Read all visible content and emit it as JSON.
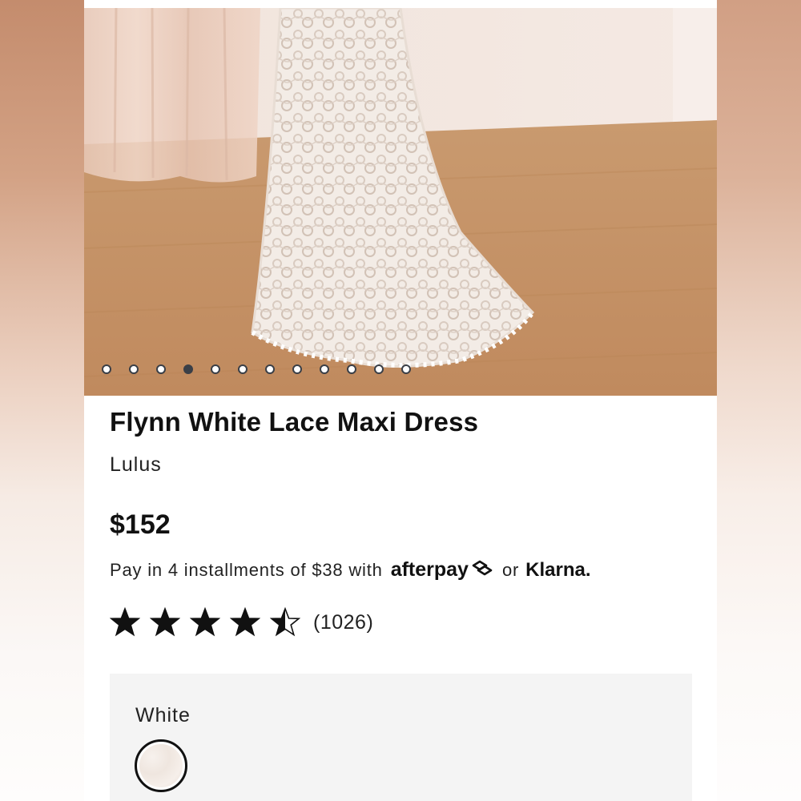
{
  "product": {
    "title": "Flynn White Lace Maxi Dress",
    "brand": "Lulus",
    "price": "$152",
    "installments_text": "Pay in 4 installments of $38 with",
    "afterpay_label": "afterpay",
    "or_text": "or",
    "klarna_label": "Klarna.",
    "rating_value": 4.5,
    "rating_max": 5,
    "review_count": "(1026)"
  },
  "gallery": {
    "image_count": 12,
    "active_index": 3
  },
  "color_selector": {
    "selected_label": "White",
    "swatches": [
      "White"
    ]
  },
  "colors": {
    "text_primary": "#111111",
    "dot_border": "#3a3f47",
    "panel_bg": "#f4f4f4"
  }
}
